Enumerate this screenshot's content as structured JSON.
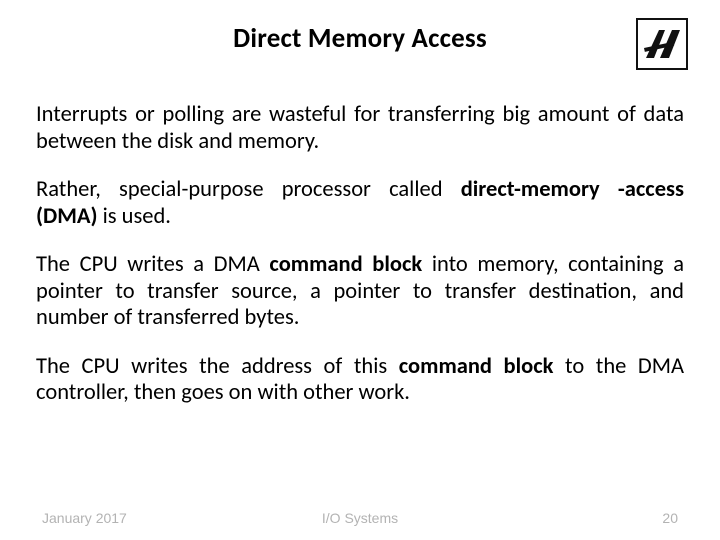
{
  "title": "Direct Memory Access",
  "paragraphs": {
    "p1": "Interrupts or polling are wasteful for transferring big amount of data between the disk and memory.",
    "p2_a": "Rather, special-purpose processor called ",
    "p2_b": "direct-memory -access (DMA)",
    "p2_c": " is used.",
    "p3_a": "The CPU writes a DMA ",
    "p3_b": "command block",
    "p3_c": " into memory, containing a pointer to transfer source, a pointer to transfer destination, and number of transferred bytes.",
    "p4_a": "The CPU writes the address of this ",
    "p4_b": "command block",
    "p4_c": " to the DMA controller, then goes on with other work."
  },
  "footer": {
    "date": "January 2017",
    "subject": "I/O Systems",
    "page": "20"
  },
  "logo": {
    "name": "technion-logo"
  }
}
